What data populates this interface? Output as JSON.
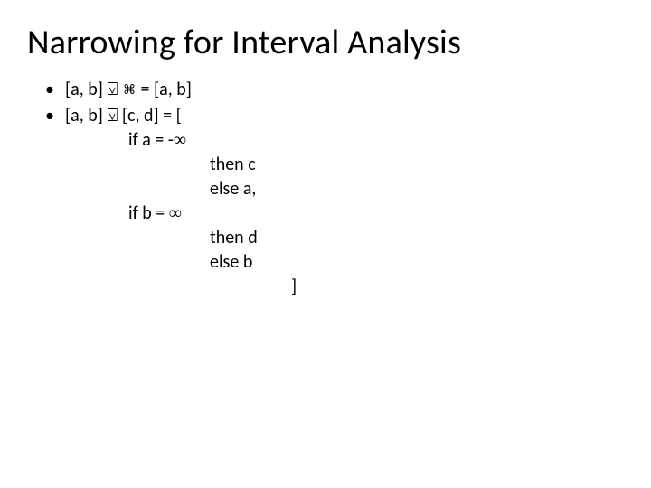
{
  "title": "Narrowing for Interval Analysis",
  "bullets": {
    "b1": {
      "lhs": "[a, b] ",
      "op": "⍌",
      "top": " ⌘ ",
      "eq": "= [a, b]"
    },
    "b2": {
      "lhs": "[a, b] ",
      "op": "⍌",
      "rhs": " [c, d] = ["
    }
  },
  "lines": {
    "if_a": "if a = -",
    "inf1": "∞",
    "then_c": "then c",
    "else_a": "else a,",
    "if_b": "if b = ",
    "inf2": "∞",
    "then_d": "then d",
    "else_b": "else b",
    "close": "]"
  }
}
